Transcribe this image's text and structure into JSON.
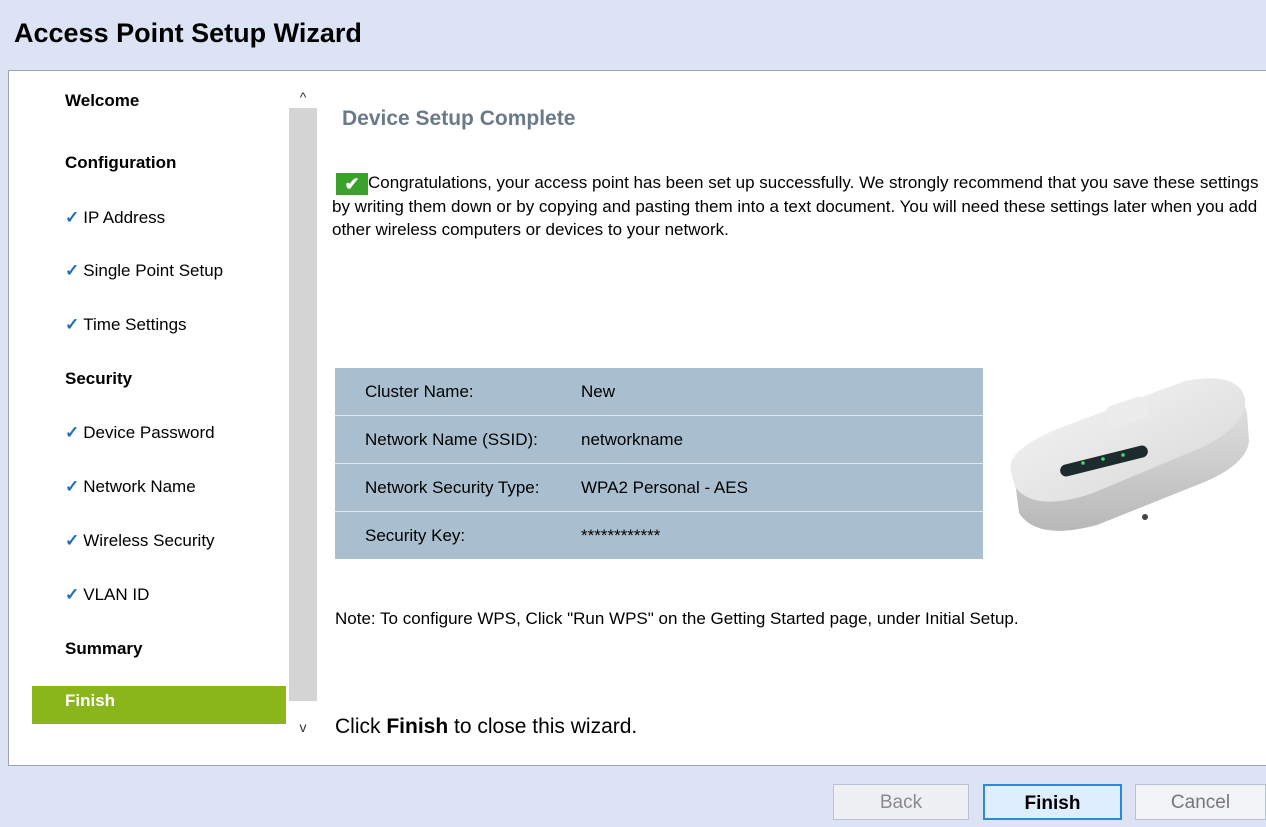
{
  "window": {
    "title": "Access Point Setup Wizard"
  },
  "sidebar": {
    "items": [
      {
        "label": "Welcome",
        "kind": "section"
      },
      {
        "label": "Configuration",
        "kind": "section"
      },
      {
        "label": "IP Address",
        "kind": "step",
        "done": true
      },
      {
        "label": "Single Point Setup",
        "kind": "step",
        "done": true
      },
      {
        "label": "Time Settings",
        "kind": "step",
        "done": true
      },
      {
        "label": "Security",
        "kind": "section"
      },
      {
        "label": "Device Password",
        "kind": "step",
        "done": true
      },
      {
        "label": "Network Name",
        "kind": "step",
        "done": true
      },
      {
        "label": "Wireless Security",
        "kind": "step",
        "done": true
      },
      {
        "label": "VLAN ID",
        "kind": "step",
        "done": true
      },
      {
        "label": "Summary",
        "kind": "section"
      },
      {
        "label": "Finish",
        "kind": "section",
        "active": true
      }
    ],
    "check_glyph": "✓"
  },
  "scrollbar": {
    "up_glyph": "^",
    "down_glyph": "v"
  },
  "main": {
    "title": "Device Setup Complete",
    "success_icon": "checkmark-icon",
    "success_glyph": "✔",
    "message": "Congratulations, your access point has been set up successfully. We strongly recommend that you save these settings by writing them down or by copying and pasting them into a text document. You will need these settings later when you add other wireless computers or devices to your network.",
    "settings": [
      {
        "label": "Cluster Name:",
        "value": "New"
      },
      {
        "label": "Network Name (SSID):",
        "value": "networkname"
      },
      {
        "label": "Network Security Type:",
        "value": "WPA2 Personal - AES"
      },
      {
        "label": "Security Key:",
        "value": "************"
      }
    ],
    "note": "Note: To configure WPS, Click \"Run WPS\" on the Getting Started page, under Initial Setup.",
    "closing_prefix": "Click ",
    "closing_bold": "Finish",
    "closing_suffix": " to close this wizard."
  },
  "footer": {
    "back_label": "Back",
    "finish_label": "Finish",
    "cancel_label": "Cancel"
  },
  "colors": {
    "accent_active": "#8ab61c",
    "table_bg": "#a9bfcf",
    "title_bar_bg": "#dce3f5",
    "check_blue": "#1f6fb8",
    "success_green": "#3aa12a"
  }
}
